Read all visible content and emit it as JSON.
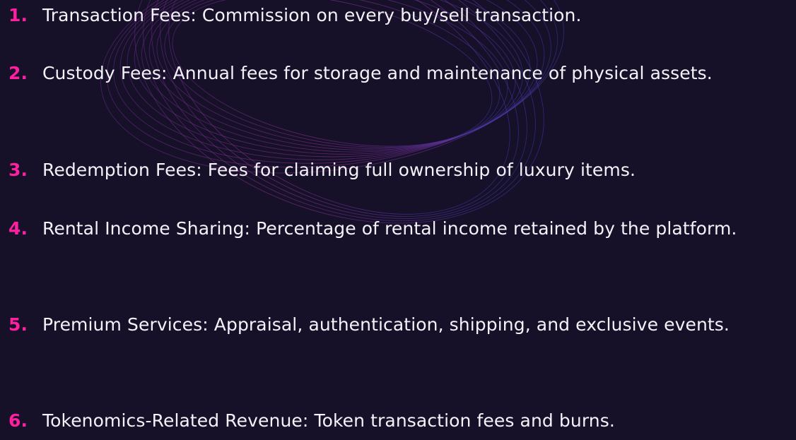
{
  "items": [
    {
      "number": "1.",
      "text": "Transaction Fees: Commission on every buy/sell transaction."
    },
    {
      "number": "2.",
      "text": "Custody Fees: Annual fees for storage and maintenance of physical assets."
    },
    {
      "number": "3.",
      "text": "Redemption Fees: Fees for claiming full ownership of luxury items."
    },
    {
      "number": "4.",
      "text": "Rental Income Sharing: Percentage of rental income retained by the platform."
    },
    {
      "number": "5.",
      "text": "Premium Services: Appraisal, authentication, shipping, and exclusive events."
    },
    {
      "number": "6.",
      "text": "Tokenomics-Related Revenue: Token transaction fees and burns."
    }
  ],
  "colors": {
    "background": "#161129",
    "number": "#ff1fa0",
    "text": "#f4f2f8"
  }
}
